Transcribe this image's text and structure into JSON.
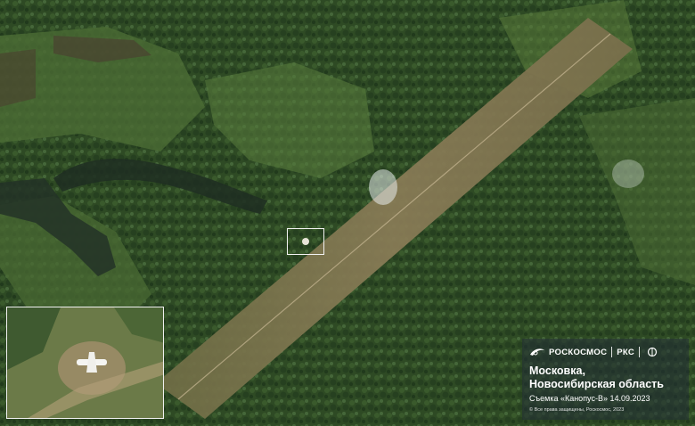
{
  "caption": {
    "brand": "РОСКОСМОС",
    "brand_secondary": "РКС",
    "location_line1": "Московка,",
    "location_line2": "Новосибирская область",
    "capture_info": "Съемка «Канопус-В» 14.09.2023",
    "copyright": "© Все права защищены, Роскосмос, 2023"
  },
  "icons": [
    "roscosmos-logo-icon",
    "rks-logo-icon"
  ],
  "colors": {
    "forest": "#2f4a25",
    "field": "#4f6b35",
    "runway": "#8a7a55",
    "caption_bg": "#232d37",
    "frame": "#f0f0f0"
  }
}
